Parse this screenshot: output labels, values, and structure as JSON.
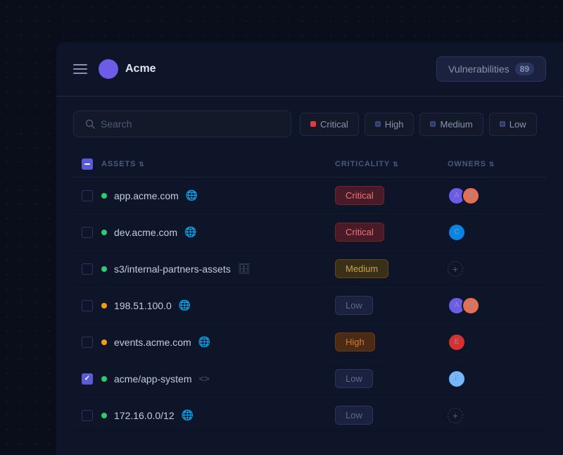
{
  "app": {
    "brand": "Acme",
    "vuln_label": "Vulnerabilities",
    "vuln_count": "89"
  },
  "toolbar": {
    "search_placeholder": "Search",
    "filters": [
      {
        "id": "critical",
        "label": "Critical",
        "dot_class": "dot-critical"
      },
      {
        "id": "high",
        "label": "High",
        "dot_class": "dot-high"
      },
      {
        "id": "medium",
        "label": "Medium",
        "dot_class": "dot-medium"
      },
      {
        "id": "low",
        "label": "Low",
        "dot_class": "dot-low"
      }
    ]
  },
  "table": {
    "columns": [
      {
        "id": "assets",
        "label": "ASSETS"
      },
      {
        "id": "criticality",
        "label": "CRITICALITY"
      },
      {
        "id": "owners",
        "label": "OWNERS"
      }
    ],
    "rows": [
      {
        "id": 1,
        "asset_name": "app.acme.com",
        "asset_icon": "globe",
        "status": "green",
        "criticality": "Critical",
        "badge_class": "badge-critical",
        "checked": false,
        "owners": [
          "a",
          "b"
        ]
      },
      {
        "id": 2,
        "asset_name": "dev.acme.com",
        "asset_icon": "globe",
        "status": "green",
        "criticality": "Critical",
        "badge_class": "badge-critical",
        "checked": false,
        "owners": [
          "c"
        ]
      },
      {
        "id": 3,
        "asset_name": "s3/internal-partners-assets",
        "asset_icon": "db",
        "status": "green",
        "criticality": "Medium",
        "badge_class": "badge-medium",
        "checked": false,
        "owners": []
      },
      {
        "id": 4,
        "asset_name": "198.51.100.0",
        "asset_icon": "globe",
        "status": "orange",
        "criticality": "Low",
        "badge_class": "badge-low",
        "checked": false,
        "owners": [
          "a",
          "b"
        ]
      },
      {
        "id": 5,
        "asset_name": "events.acme.com",
        "asset_icon": "globe",
        "status": "orange",
        "criticality": "High",
        "badge_class": "badge-high",
        "checked": false,
        "owners": [
          "e"
        ]
      },
      {
        "id": 6,
        "asset_name": "acme/app-system",
        "asset_icon": "code",
        "status": "green",
        "criticality": "Low",
        "badge_class": "badge-low",
        "checked": true,
        "owners": [
          "f"
        ]
      },
      {
        "id": 7,
        "asset_name": "172.16.0.0/12",
        "asset_icon": "globe",
        "status": "green",
        "criticality": "Low",
        "badge_class": "badge-low",
        "checked": false,
        "owners": []
      }
    ]
  }
}
